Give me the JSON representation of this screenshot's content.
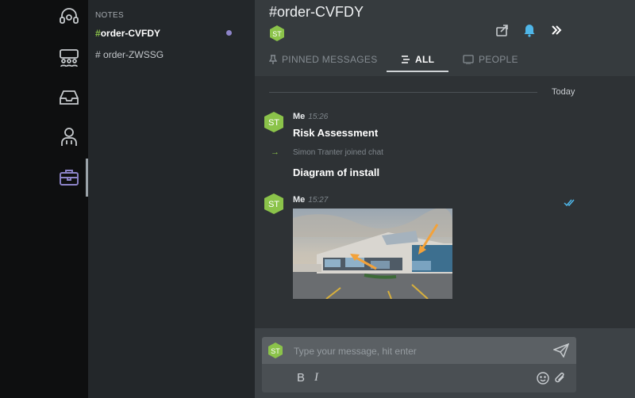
{
  "sidebar": {
    "rail": [
      {
        "name": "support-icon"
      },
      {
        "name": "team-icon"
      },
      {
        "name": "inbox-icon"
      },
      {
        "name": "contacts-icon"
      },
      {
        "name": "briefcase-icon"
      }
    ],
    "section_label": "NOTES",
    "channels": [
      {
        "hash": "#",
        "label": "order-CVFDY",
        "active": true,
        "unread": true
      },
      {
        "hash": "#",
        "label": "order-ZWSSG",
        "active": false
      }
    ]
  },
  "header": {
    "hash": "#",
    "title": "order-CVFDY",
    "avatar_initials": "ST",
    "icons": [
      "share-icon",
      "bell-icon",
      "expand-icon"
    ]
  },
  "tabs": [
    {
      "label": "PINNED MESSAGES",
      "icon": "pin-icon"
    },
    {
      "label": "ALL",
      "icon": "list-icon",
      "active": true
    },
    {
      "label": "PEOPLE",
      "icon": "people-icon"
    }
  ],
  "feed": {
    "day_label": "Today",
    "messages": [
      {
        "avatar": "ST",
        "author": "Me",
        "time": "15:26",
        "text": "Risk Assessment"
      },
      {
        "system": "Simon Tranter joined chat",
        "arrow": "→"
      },
      {
        "text": "Diagram of install"
      },
      {
        "avatar": "ST",
        "author": "Me",
        "time": "15:27",
        "attachment": "building-photo"
      }
    ]
  },
  "composer": {
    "avatar": "ST",
    "placeholder": "Type your message, hit enter",
    "bold": "B",
    "italic": "I"
  },
  "colors": {
    "accent_green": "#8bc34a",
    "rail_active": "#8d84c9",
    "read_check": "#4fb6e8"
  }
}
